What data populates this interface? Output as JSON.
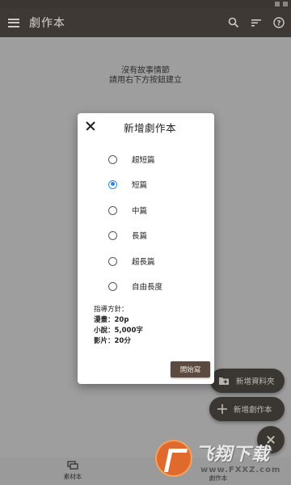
{
  "app": {
    "title": "劇作本"
  },
  "toolbar": {
    "icons": [
      "search-icon",
      "sort-icon",
      "help-icon"
    ]
  },
  "main": {
    "empty_line1": "沒有故事情節",
    "empty_line2": "請用右下方按鈕建立"
  },
  "dialog": {
    "title": "新增劇作本",
    "options": [
      {
        "label": "超短篇",
        "checked": false
      },
      {
        "label": "短篇",
        "checked": true
      },
      {
        "label": "中篇",
        "checked": false
      },
      {
        "label": "長篇",
        "checked": false
      },
      {
        "label": "超長篇",
        "checked": false
      },
      {
        "label": "自由長度",
        "checked": false
      }
    ],
    "guide_heading": "指導方針：",
    "guide_comic": "漫畫：20p",
    "guide_novel": "小說：5,000字",
    "guide_film": "影片：20分",
    "start_label": "開始寫"
  },
  "fabs": {
    "new_folder": "新增資料夾",
    "new_script": "新增劇作本"
  },
  "bottom_nav": {
    "materials": "素材本",
    "scripts": "劇作本"
  },
  "watermark": {
    "text": "飞翔下载",
    "url": "www.FXXZ.com"
  },
  "colors": {
    "app_bar": "#3e3934",
    "accent": "#2f89e0",
    "start_button": "#5b4a3f",
    "watermark_orange": "#e06a2c"
  }
}
